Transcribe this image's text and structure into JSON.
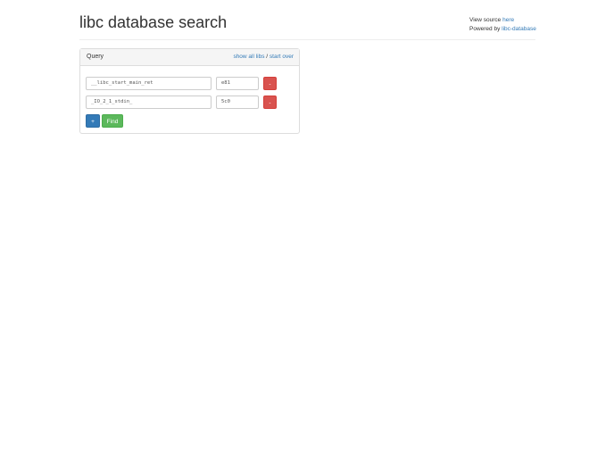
{
  "header": {
    "title": "libc database search",
    "view_source": "View source ",
    "here": "here",
    "powered_by": "Powered by ",
    "libc_database": "libc-database"
  },
  "panel": {
    "title": "Query",
    "show_all": "show all libs",
    "sep": " / ",
    "start_over": "start over",
    "rows": [
      {
        "symbol": "__libc_start_main_ret",
        "address": "e81",
        "remove": "-"
      },
      {
        "symbol": "_IO_2_1_stdin_",
        "address": "5c0",
        "remove": "-"
      }
    ],
    "add": "+",
    "find": "Find"
  }
}
